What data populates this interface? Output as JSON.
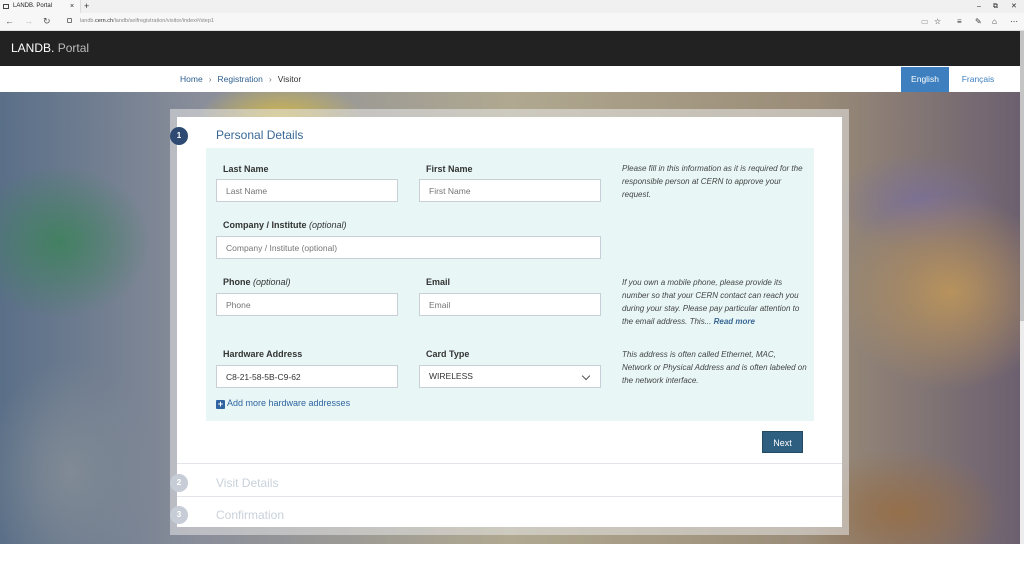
{
  "browser": {
    "tab_title": "LANDB. Portal",
    "tab_close": "×",
    "new_tab": "+",
    "url_prefix": "landb.",
    "url_domain": "cern.ch",
    "url_path": "/landb/selfregistration/visitor/index#/step1",
    "window_controls": [
      "–",
      "⧉",
      "✕"
    ],
    "nav": {
      "back": "←",
      "forward": "→",
      "refresh": "↻"
    },
    "tools": [
      "▭",
      "☆",
      "≡",
      "✎",
      "⌂",
      "⋯"
    ]
  },
  "header": {
    "brand_main": "LANDB.",
    "brand_sub": " Portal"
  },
  "breadcrumb": {
    "items": [
      "Home",
      "Registration"
    ],
    "separator": "›",
    "current": "Visitor"
  },
  "languages": {
    "active": "English",
    "other": "Français"
  },
  "steps": [
    {
      "number": "1",
      "title": "Personal Details"
    },
    {
      "number": "2",
      "title": "Visit Details"
    },
    {
      "number": "3",
      "title": "Confirmation"
    }
  ],
  "form": {
    "last_name": {
      "label": "Last Name",
      "placeholder": "Last Name",
      "value": ""
    },
    "first_name": {
      "label": "First Name",
      "placeholder": "First Name",
      "value": ""
    },
    "company": {
      "label": "Company / Institute",
      "optional": "(optional)",
      "placeholder": "Company / Institute (optional)",
      "value": ""
    },
    "phone": {
      "label": "Phone",
      "optional": "(optional)",
      "placeholder": "Phone",
      "value": ""
    },
    "email": {
      "label": "Email",
      "placeholder": "Email",
      "value": ""
    },
    "hardware_address": {
      "label": "Hardware Address",
      "value": "C8-21-58-5B-C9-62"
    },
    "card_type": {
      "label": "Card Type",
      "value": "WIRELESS"
    },
    "add_hardware": "Add more hardware addresses",
    "next": "Next"
  },
  "help": {
    "personal": "Please fill in this information as it is required for the responsible person at CERN to approve your request.",
    "contact": "If you own a mobile phone, please provide its number so that your CERN contact can reach you during your stay. Please pay particular attention to the email address. This...",
    "contact_more": "Read more",
    "hardware": "This address is often called Ethernet, MAC, Network or Physical Address and is often labeled on the network interface."
  },
  "colors": {
    "header_bg": "#222222",
    "accent": "#3d7fbf",
    "panel_bg": "#e8f7f6",
    "step_active": "#2f4a72",
    "button": "#2f5f80"
  }
}
